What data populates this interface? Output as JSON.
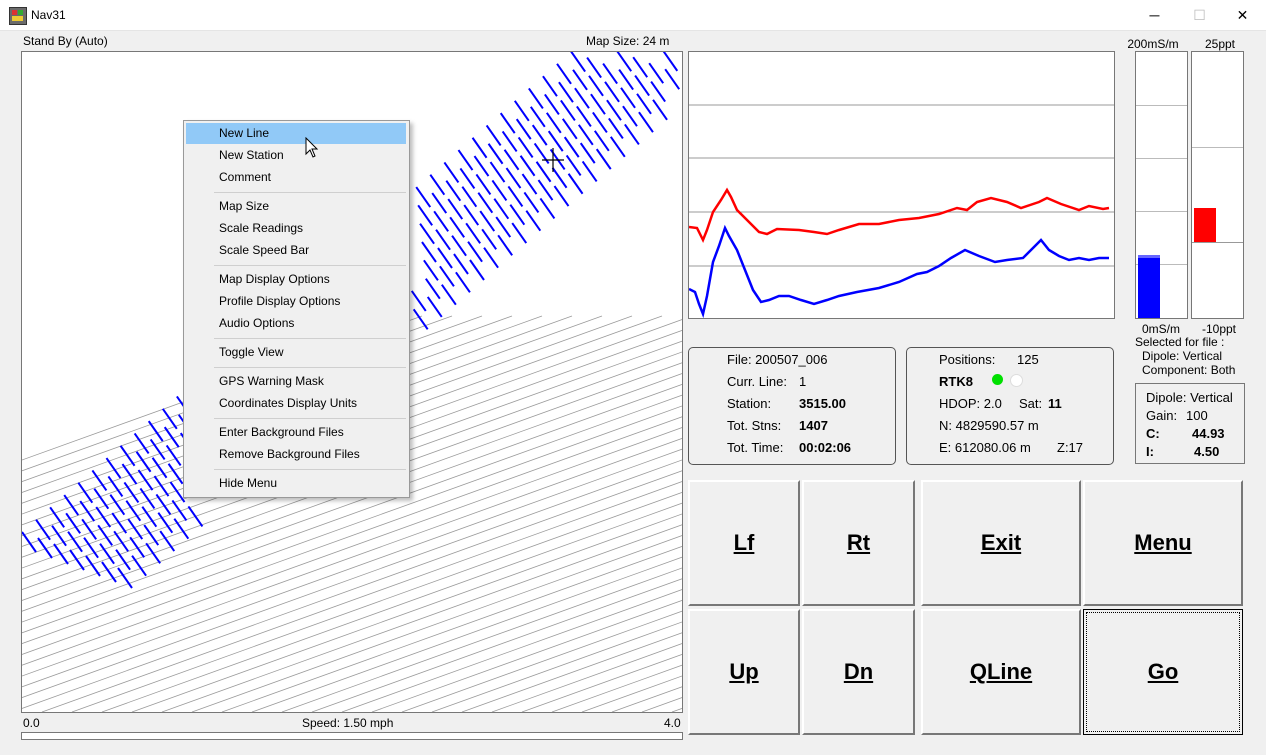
{
  "window": {
    "title": "Nav31",
    "min": "─",
    "max": "☐",
    "close": "✕"
  },
  "map": {
    "status": "Stand By (Auto)",
    "map_size_label": "Map Size:  24 m",
    "speed_min": "0.0",
    "speed_label": "Speed:  1.50 mph",
    "speed_max": "4.0"
  },
  "menu": {
    "items": [
      "New Line",
      "New Station",
      "Comment",
      "Map Size",
      "Scale Readings",
      "Scale Speed Bar",
      "Map Display Options",
      "Profile Display Options",
      "Audio Options",
      "Toggle View",
      "GPS Warning Mask",
      "Coordinates Display Units",
      "Enter Background Files",
      "Remove Background Files",
      "Hide Menu"
    ],
    "highlighted": "New Line"
  },
  "bars": {
    "c_top": "200mS/m",
    "c_bottom": "0mS/m",
    "i_top": "25ppt",
    "i_bottom": "-10ppt",
    "c_level": 0.225,
    "i_level": 0.4,
    "c_color": "#0000ff",
    "i_color": "#ff0000"
  },
  "selected": {
    "line1": "Selected for file :",
    "line2": "Dipole: Vertical",
    "line3": "Component: Both"
  },
  "file_panel": {
    "file": "File: 200507_006",
    "curr_line_label": "Curr. Line:",
    "curr_line": "1",
    "station_label": "Station:",
    "station": "3515.00",
    "tot_stns_label": "Tot. Stns:",
    "tot_stns": "1407",
    "tot_time_label": "Tot. Time:",
    "tot_time": "00:02:06"
  },
  "gps_panel": {
    "positions_label": "Positions:",
    "positions": "125",
    "fix": "RTK8",
    "hdop": "HDOP: 2.0",
    "sat_label": "Sat:",
    "sat": "11",
    "n": "N:  4829590.57 m",
    "e": "E:   612080.06 m",
    "z": "Z:17",
    "led1": "#00e000",
    "led2": "#ffffff"
  },
  "dipole_panel": {
    "dipole": "Dipole: Vertical",
    "gain_label": "Gain:",
    "gain": "100",
    "c_label": "C:",
    "c": "44.93",
    "i_label": "I:",
    "i": "4.50"
  },
  "buttons": {
    "lf": "Lf",
    "rt": "Rt",
    "exit": "Exit",
    "menu": "Menu",
    "up": "Up",
    "dn": "Dn",
    "qline": "QLine",
    "go": "Go"
  },
  "profile_colors": {
    "c": "#ff0000",
    "i": "#0000ff"
  }
}
